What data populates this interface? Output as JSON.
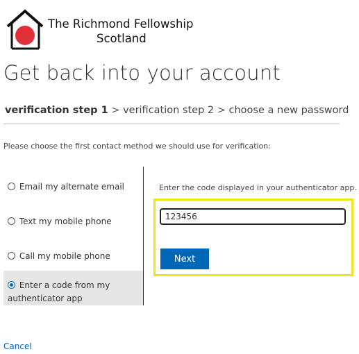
{
  "header": {
    "org_line1": "The Richmond Fellowship",
    "org_line2": "Scotland",
    "logo_icon": "house-with-red-circle-logo"
  },
  "page": {
    "title": "Get back into your account"
  },
  "steps": {
    "step1": "verification step 1",
    "step2": "verification step 2",
    "step3": "choose a new password",
    "separator": ">"
  },
  "instruction": "Please choose the first contact method we should use for verification:",
  "methods": {
    "items": [
      {
        "label": "Email my alternate email",
        "selected": false
      },
      {
        "label": "Text my mobile phone",
        "selected": false
      },
      {
        "label": "Call my mobile phone",
        "selected": false
      },
      {
        "label_line1": "Enter a code from my",
        "label_line2": "authenticator app",
        "selected": true
      }
    ]
  },
  "auth": {
    "prompt": "Enter the code displayed in your authenticator app.",
    "code_value": "123456",
    "next_label": "Next"
  },
  "footer": {
    "cancel_label": "Cancel"
  },
  "colors": {
    "accent": "#0067b8",
    "highlight": "#f4e21b",
    "selected_bg": "#e6e6e6",
    "logo_red": "#e0313a"
  }
}
